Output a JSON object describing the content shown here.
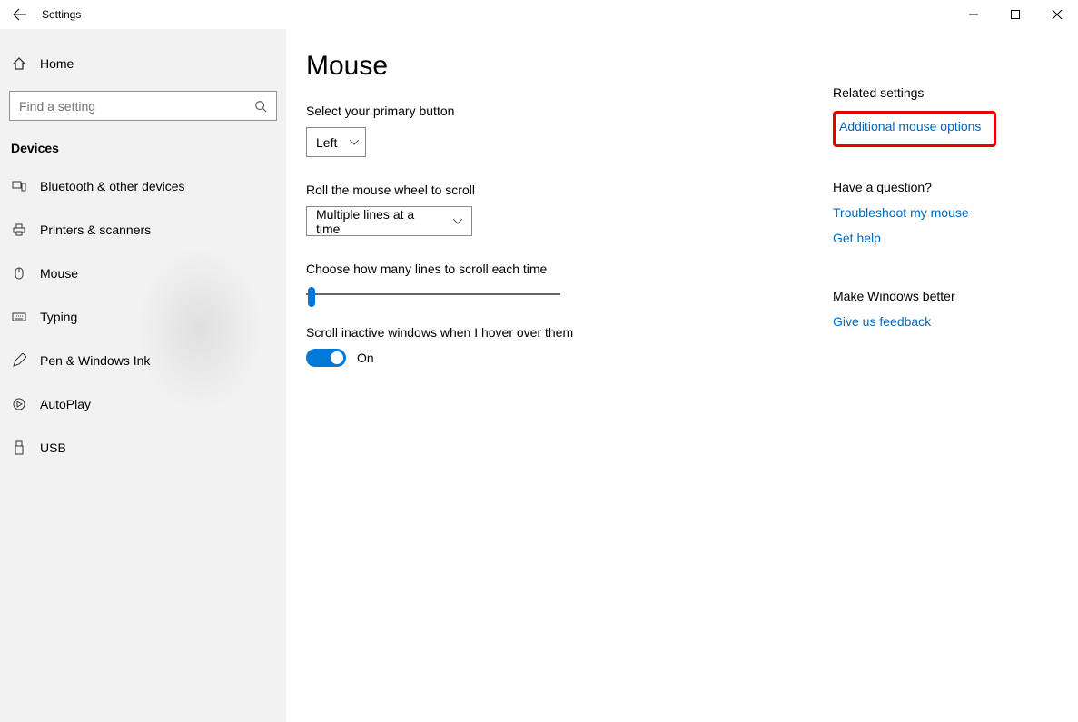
{
  "window": {
    "title": "Settings"
  },
  "sidebar": {
    "home": "Home",
    "search_placeholder": "Find a setting",
    "section": "Devices",
    "items": [
      {
        "label": "Bluetooth & other devices"
      },
      {
        "label": "Printers & scanners"
      },
      {
        "label": "Mouse"
      },
      {
        "label": "Typing"
      },
      {
        "label": "Pen & Windows Ink"
      },
      {
        "label": "AutoPlay"
      },
      {
        "label": "USB"
      }
    ]
  },
  "page": {
    "title": "Mouse",
    "primary_button_label": "Select your primary button",
    "primary_button_value": "Left",
    "wheel_scroll_label": "Roll the mouse wheel to scroll",
    "wheel_scroll_value": "Multiple lines at a time",
    "lines_label": "Choose how many lines to scroll each time",
    "inactive_label": "Scroll inactive windows when I hover over them",
    "inactive_value": "On"
  },
  "right": {
    "related_heading": "Related settings",
    "related_link": "Additional mouse options",
    "question_heading": "Have a question?",
    "troubleshoot_link": "Troubleshoot my mouse",
    "help_link": "Get help",
    "better_heading": "Make Windows better",
    "feedback_link": "Give us feedback"
  }
}
